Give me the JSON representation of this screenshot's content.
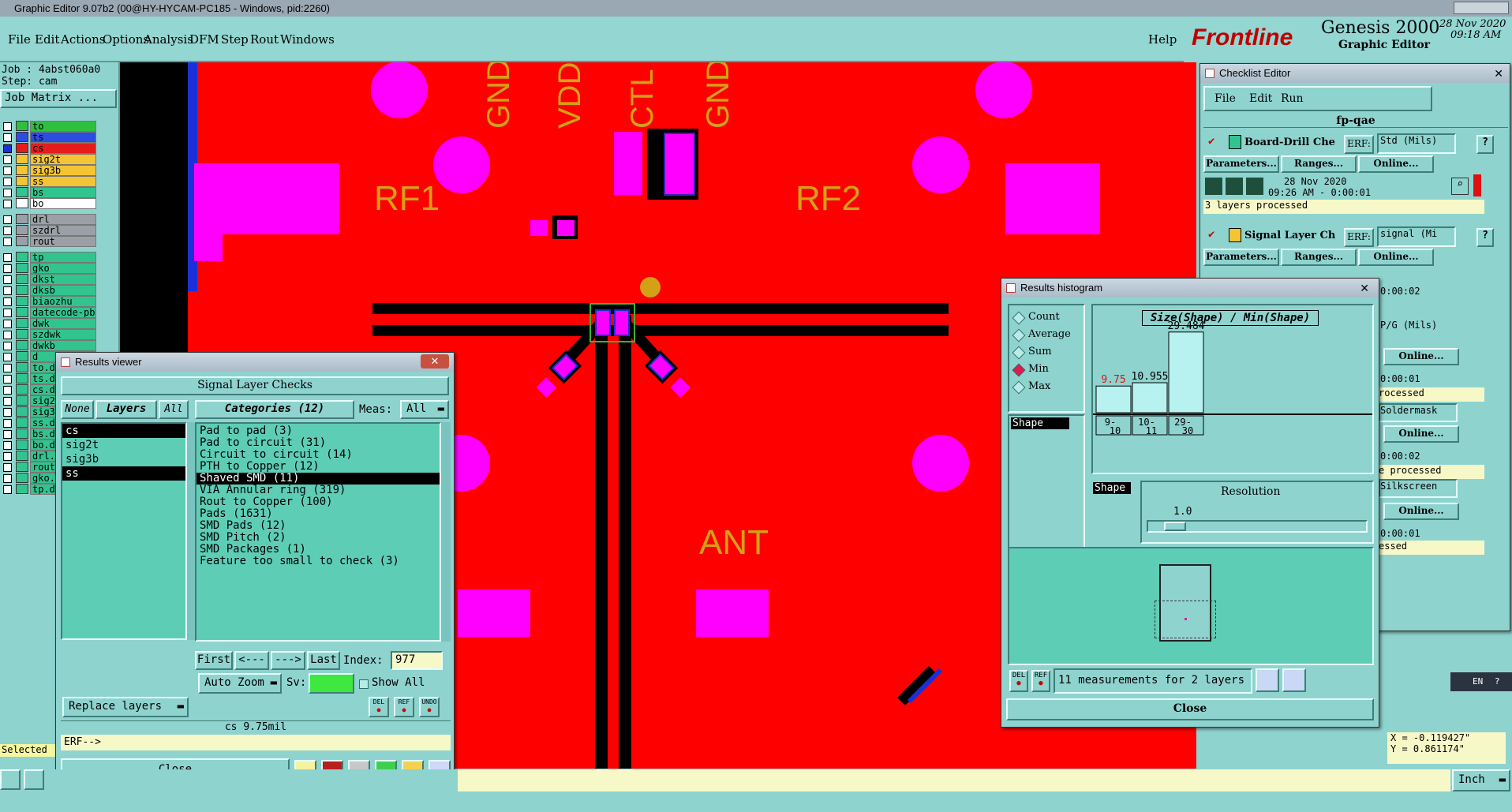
{
  "window_title": "Graphic Editor 9.07b2 (00@HY-HYCAM-PC185 - Windows, pid:2260)",
  "menu": [
    "File",
    "Edit",
    "Actions",
    "Options",
    "Analysis",
    "DFM",
    "Step",
    "Rout",
    "Windows"
  ],
  "help": "Help",
  "brand": {
    "logo": "Frontline",
    "product": "Genesis 2000",
    "subtitle": "Graphic Editor",
    "date": "28 Nov 2020",
    "time": "09:18 AM"
  },
  "job": {
    "job_label": "Job : 4abst060a0",
    "step_label": "Step: cam",
    "job_matrix": "Job Matrix ..."
  },
  "layers": [
    {
      "name": "to",
      "color": "#2fbf3f",
      "on": false
    },
    {
      "name": "ts",
      "color": "#2d4ce0",
      "on": false
    },
    {
      "name": "cs",
      "color": "#e41c1c",
      "on": true
    },
    {
      "name": "sig2t",
      "color": "#f4c435",
      "on": false
    },
    {
      "name": "sig3b",
      "color": "#f4c435",
      "on": false
    },
    {
      "name": "ss",
      "color": "#f4c435",
      "on": false
    },
    {
      "name": "bs",
      "color": "#31c48f",
      "on": false
    },
    {
      "name": "bo",
      "color": "#ffffff",
      "on": false
    },
    {
      "name": "drl",
      "color": "#9aa0a6",
      "on": false
    },
    {
      "name": "szdrl",
      "color": "#9aa0a6",
      "on": false
    },
    {
      "name": "rout",
      "color": "#9aa0a6",
      "on": false
    },
    {
      "name": "tp",
      "color": "#31c48f",
      "on": false
    },
    {
      "name": "gko",
      "color": "#31c48f",
      "on": false
    },
    {
      "name": "dkst",
      "color": "#31c48f",
      "on": false
    },
    {
      "name": "dksb",
      "color": "#31c48f",
      "on": false
    },
    {
      "name": "biaozhu",
      "color": "#31c48f",
      "on": false
    },
    {
      "name": "datecode-pbe",
      "color": "#31c48f",
      "on": false
    },
    {
      "name": "dwk",
      "color": "#31c48f",
      "on": false
    },
    {
      "name": "szdwk",
      "color": "#31c48f",
      "on": false
    },
    {
      "name": "dwkb",
      "color": "#31c48f",
      "on": false
    },
    {
      "name": "d",
      "color": "#31c48f",
      "on": false
    },
    {
      "name": "to.d",
      "color": "#31c48f",
      "on": false
    },
    {
      "name": "ts.d",
      "color": "#31c48f",
      "on": false
    },
    {
      "name": "cs.d",
      "color": "#31c48f",
      "on": false
    },
    {
      "name": "sig2",
      "color": "#31c48f",
      "on": false
    },
    {
      "name": "sig3",
      "color": "#31c48f",
      "on": false
    },
    {
      "name": "ss.d",
      "color": "#31c48f",
      "on": false
    },
    {
      "name": "bs.d",
      "color": "#31c48f",
      "on": false
    },
    {
      "name": "bo.d",
      "color": "#31c48f",
      "on": false
    },
    {
      "name": "drl.",
      "color": "#31c48f",
      "on": false
    },
    {
      "name": "rout",
      "color": "#31c48f",
      "on": false
    },
    {
      "name": "gko.",
      "color": "#31c48f",
      "on": false
    },
    {
      "name": "tp.d",
      "color": "#31c48f",
      "on": false
    }
  ],
  "selected_label": "Selected",
  "canvas_labels": {
    "gnd1": "GND",
    "vdd": "VDD",
    "ctl": "CTL",
    "gnd2": "GND",
    "rf1": "RF1",
    "rf2": "RF2",
    "ant": "ANT"
  },
  "results_viewer": {
    "title": "Results viewer",
    "heading": "Signal Layer Checks",
    "none": "None",
    "layers": "Layers",
    "all": "All",
    "categories_label": "Categories (12)",
    "meas_label": "Meas:",
    "meas_value": "All",
    "layer_list": [
      "cs",
      "sig2t",
      "sig3b",
      "ss"
    ],
    "categories": [
      "Pad to pad (3)",
      "Pad to circuit (31)",
      "Circuit to circuit (14)",
      "PTH to Copper (12)",
      "Shaved SMD (11)",
      "VIA Annular ring (319)",
      "Rout to Copper (100)",
      "Pads (1631)",
      "SMD Pads (12)",
      "SMD Pitch (2)",
      "SMD Packages (1)",
      "Feature too small to check (3)"
    ],
    "selected_category": "Shaved SMD (11)",
    "first": "First",
    "prev": "<---",
    "next": "--->",
    "last": "Last",
    "index_label": "Index:",
    "index_value": "977",
    "zoom": "Auto Zoom",
    "sv": "Sv:",
    "show_all": "Show All",
    "replace_layers": "Replace layers",
    "status": "cs 9.75mil",
    "erf": "ERF-->",
    "close": "Close",
    "del": "DEL",
    "ref": "REF",
    "undo": "UNDO"
  },
  "checklist": {
    "title": "Checklist Editor",
    "menu": [
      "File",
      "Edit",
      "Run"
    ],
    "name": "fp-qae",
    "checks": [
      {
        "name": "Board-Drill Che",
        "erf": "ERF:",
        "erf_value": "Std (Mils)",
        "date": "28 Nov 2020",
        "time": "09:26 AM - 0:00:01",
        "status": "3 layers processed"
      },
      {
        "name": "Signal Layer Ch",
        "erf": "ERF:",
        "erf_value": "signal (Mi",
        "date": "",
        "time": "0:00:02",
        "status": ""
      }
    ],
    "extra_values": [
      "P/G (Mils)",
      "0:00:01",
      "rocessed",
      "Soldermask",
      "0:00:02",
      "e processed",
      "Silkscreen",
      "0:00:01",
      "essed"
    ],
    "params": "Parameters...",
    "ranges": "Ranges...",
    "online": "Online..."
  },
  "histogram": {
    "title": "Results histogram",
    "options": [
      "Count",
      "Average",
      "Sum",
      "Min",
      "Max"
    ],
    "selected": "Min",
    "shape_item": "Shape",
    "graph_title": "Size(Shape) / Min(Shape)",
    "bars": [
      {
        "range": "9-10",
        "value": 9.75,
        "label": "9.75"
      },
      {
        "range": "10-11",
        "value": 10.955,
        "label": "10.955"
      },
      {
        "range": "29-30",
        "value": 29.484,
        "label": "29.484"
      }
    ],
    "resolution_label": "Resolution",
    "resolution_value": "1.0",
    "summary": "11 measurements for 2 layers",
    "close": "Close"
  },
  "coords": {
    "x": "X = -0.119427\"",
    "y": "Y = 0.861174\""
  },
  "units": "Inch",
  "ime": "EN"
}
